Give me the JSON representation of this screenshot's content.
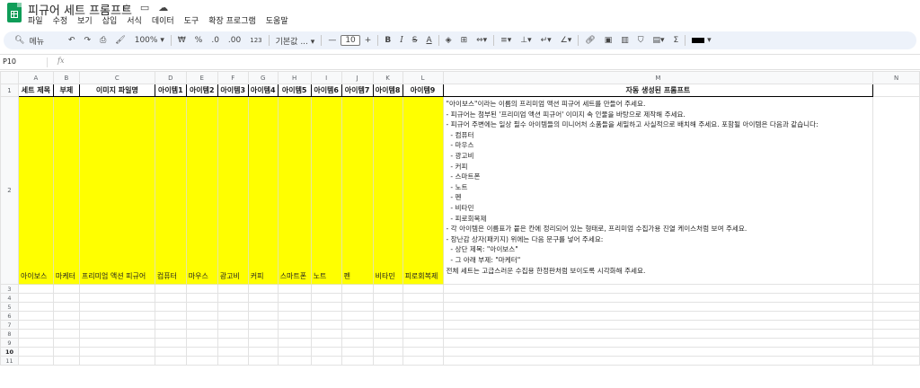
{
  "app": {
    "title": "피규어 세트 프롬프트",
    "title_icons": [
      "star-icon",
      "folder-move-icon",
      "cloud-icon"
    ],
    "menus": [
      "파일",
      "수정",
      "보기",
      "삽입",
      "서식",
      "데이터",
      "도구",
      "확장 프로그램",
      "도움말"
    ]
  },
  "toolbar": {
    "search": "메뉴",
    "zoom": "100%",
    "currency": "₩",
    "percent": "%",
    "dec_decrease": ".0",
    "dec_increase": ".00",
    "number_format": "123",
    "font": "기본값 ...",
    "font_size": "10",
    "minus": "—",
    "plus": "+",
    "bold": "B",
    "italic": "I",
    "strike": "S",
    "text_color": "A",
    "sum": "Σ"
  },
  "formula_bar": {
    "name_box": "P10",
    "fx": "fx"
  },
  "colors": {
    "highlight": "#ffff00",
    "brand": "#0f9d58"
  },
  "grid": {
    "columns": [
      "A",
      "B",
      "C",
      "D",
      "E",
      "F",
      "G",
      "H",
      "I",
      "J",
      "K",
      "L",
      "M",
      "N"
    ],
    "rows": [
      "1",
      "2",
      "3",
      "4",
      "5",
      "6",
      "7",
      "8",
      "9",
      "10",
      "11"
    ],
    "header_row": [
      "세트 제목",
      "부제",
      "이미지 파일명",
      "아이템1",
      "아이템2",
      "아이템3",
      "아이템4",
      "아이템5",
      "아이템6",
      "아이템7",
      "아이템8",
      "아이템9",
      "자동 생성된 프롬프트",
      ""
    ],
    "data_row": [
      "아이보스",
      "마케터",
      "프리미엄 액션 피규어",
      "컴퓨터",
      "마우스",
      "광고비",
      "커피",
      "스마트폰",
      "노트",
      "펜",
      "비타민",
      "피로회복제"
    ],
    "prompt_lines": [
      "\"아이보스\"이라는 이름의 프리미엄 액션 피규어 세트를 만들어 주세요.",
      "",
      "- 피규어는 첨부된 '프리미엄 액션 피규어' 이미지 속 인물을 바탕으로 제작해 주세요.",
      "- 피규어 주변에는 일상 필수 아이템들의 미니어처 소품들을 세밀하고 사실적으로 배치해 주세요. 포함될 아이템은 다음과 같습니다:",
      "  - 컴퓨터",
      "  - 마우스",
      "  - 광고비",
      "  - 커피",
      "  - 스마트폰",
      "  - 노트",
      "  - 펜",
      "  - 비타민",
      "  - 피로회복제",
      "- 각 아이템은 이름표가 붙은 칸에 정리되어 있는 형태로, 프리미엄 수집가용 진열 케이스처럼 보여 주세요.",
      "- 장난감 상자(패키지) 위에는 다음 문구를 넣어 주세요:",
      "  - 상단 제목: \"아이보스\"",
      "  - 그 아래 부제: \"마케터\"",
      "",
      "전체 세트는 고급스러운 수집용 한정판처럼 보이도록 시각화해 주세요."
    ]
  }
}
